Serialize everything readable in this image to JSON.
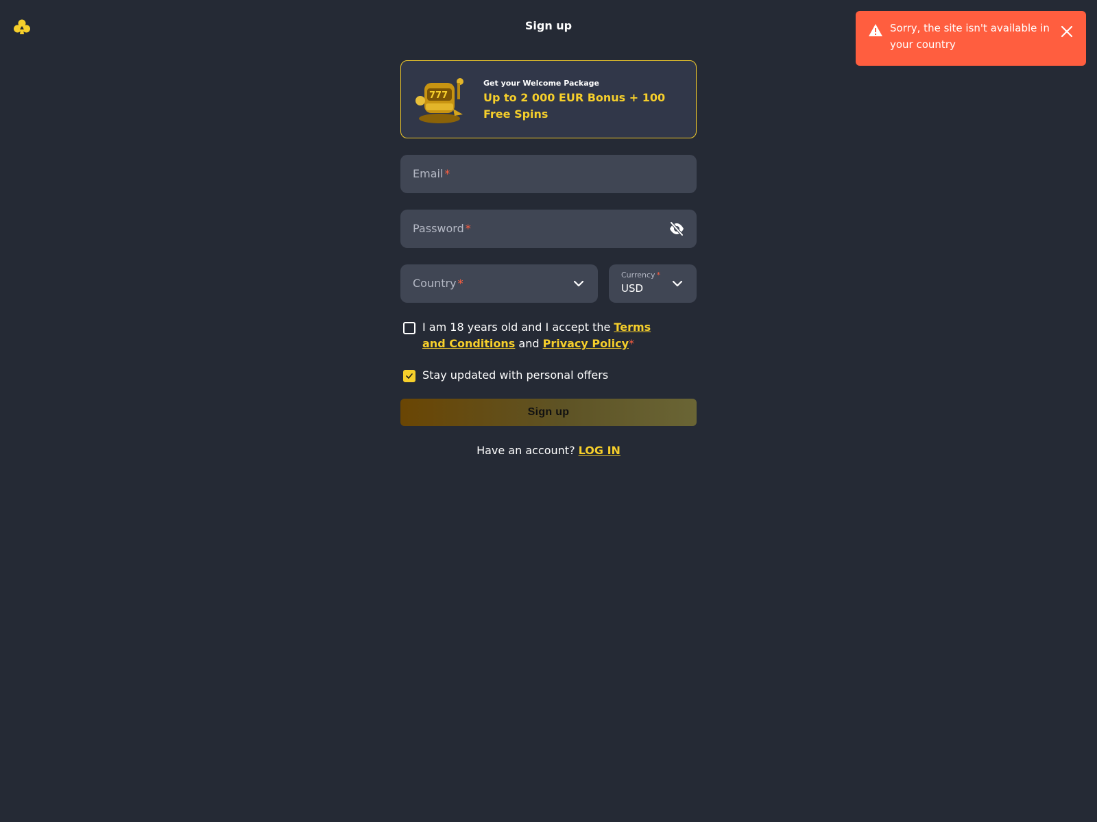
{
  "header": {
    "title": "Sign up"
  },
  "toast": {
    "message": "Sorry, the site isn't available in your country"
  },
  "promo": {
    "heading": "Get your Welcome Package",
    "offer": "Up to 2 000 EUR Bonus + 100 Free Spins"
  },
  "form": {
    "email_label": "Email",
    "password_label": "Password",
    "country_label": "Country",
    "currency_label": "Currency",
    "currency_value": "USD",
    "required_mark": "*",
    "terms_text_before": "I am 18 years old and I accept the ",
    "terms_link": "Terms and Conditions",
    "terms_and": " and ",
    "privacy_link": "Privacy Policy",
    "terms_checked": false,
    "offers_text": "Stay updated with personal offers",
    "offers_checked": true,
    "submit_label": "Sign up",
    "login_prompt": "Have an account? ",
    "login_link": "LOG IN"
  },
  "colors": {
    "background": "#252a35",
    "accent": "#f6cf2b",
    "error": "#ff5e3f",
    "field": "#404654"
  },
  "icons": [
    "club-logo-icon",
    "warning-icon",
    "close-icon",
    "slot-machine-icon",
    "eye-off-icon",
    "chevron-down-icon",
    "check-icon"
  ]
}
